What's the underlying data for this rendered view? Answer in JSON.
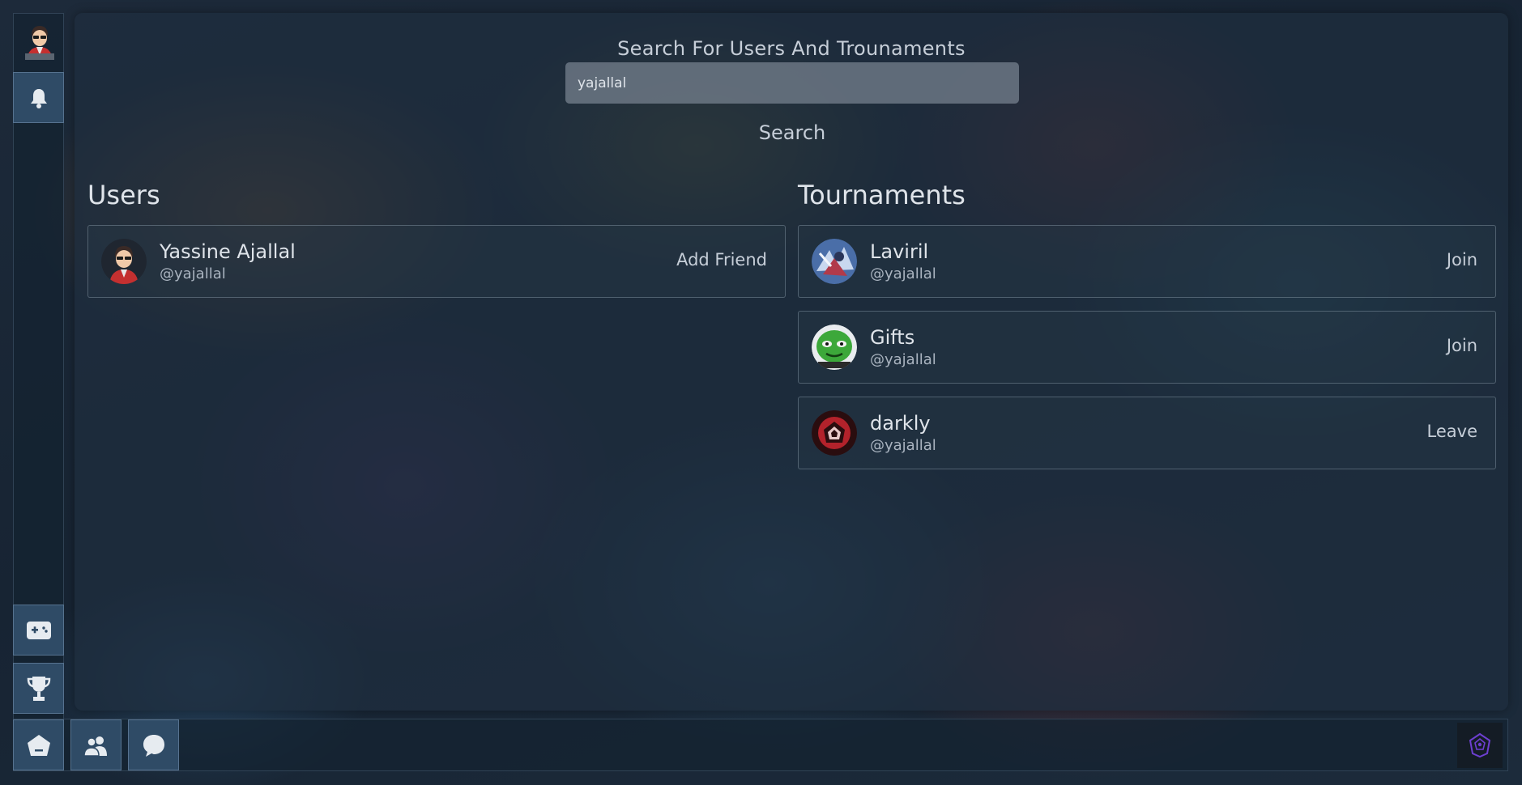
{
  "search": {
    "title": "Search For Users And Trounaments",
    "query": "yajallal",
    "button_label": "Search"
  },
  "users": {
    "heading": "Users",
    "items": [
      {
        "name": "Yassine Ajallal",
        "handle": "@yajallal",
        "action": "Add Friend"
      }
    ]
  },
  "tournaments": {
    "heading": "Tournaments",
    "items": [
      {
        "name": "Laviril",
        "handle": "@yajallal",
        "action": "Join"
      },
      {
        "name": "Gifts",
        "handle": "@yajallal",
        "action": "Join"
      },
      {
        "name": "darkly",
        "handle": "@yajallal",
        "action": "Leave"
      }
    ]
  },
  "sidebar": {
    "items": [
      {
        "icon": "bell-icon"
      },
      {
        "icon": "gamepad-icon"
      },
      {
        "icon": "trophy-icon"
      }
    ]
  },
  "bottom_nav": {
    "items": [
      {
        "icon": "home-icon"
      },
      {
        "icon": "friends-icon"
      },
      {
        "icon": "chat-icon"
      }
    ],
    "logo_icon": "app-logo-icon"
  },
  "colors": {
    "button_bg": "#2f4b66",
    "panel_bg": "#1e2e3e",
    "accent_logo": "#6d3fd0"
  }
}
